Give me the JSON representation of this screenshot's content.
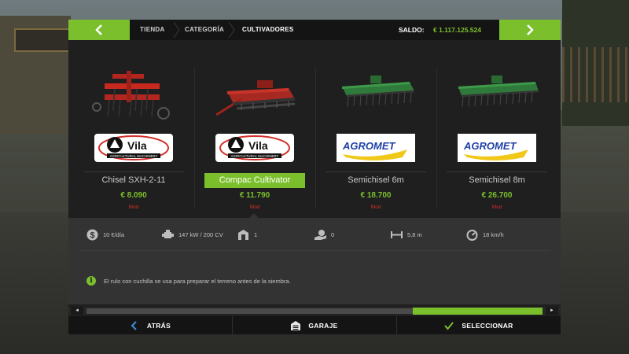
{
  "breadcrumb": [
    "TIENDA",
    "CATEGORÍA",
    "CULTIVADORES"
  ],
  "balance": {
    "label": "SALDO:",
    "value": "€ 1.117.125.524"
  },
  "items": [
    {
      "name": "Chisel SXH-2-11",
      "price": "€ 8.090",
      "tag": "Mod",
      "brand": "Vila",
      "brand_sub": "AGRICULTURAL MACHINERY"
    },
    {
      "name": "Compac Cultivator",
      "price": "€ 11.790",
      "tag": "Mod",
      "brand": "Vila",
      "brand_sub": "AGRICULTURAL MACHINERY"
    },
    {
      "name": "Semichisel 6m",
      "price": "€ 18.700",
      "tag": "Mod",
      "brand": "AGROMET"
    },
    {
      "name": "Semichisel 8m",
      "price": "€ 26.700",
      "tag": "Mod",
      "brand": "AGROMET"
    }
  ],
  "specs": [
    {
      "icon": "dollar-coin-icon",
      "value": "10 €/día"
    },
    {
      "icon": "engine-icon",
      "value": "147 kW / 200 CV"
    },
    {
      "icon": "barn-icon",
      "value": "1"
    },
    {
      "icon": "hand-money-icon",
      "value": "0"
    },
    {
      "icon": "width-icon",
      "value": "5,8 m"
    },
    {
      "icon": "speedometer-icon",
      "value": "18 km/h"
    }
  ],
  "description": "El rulo con cuchilla se usa para preparar el terreno antes de la siembra.",
  "info_icon": "i",
  "buttons": {
    "back": "ATRÁS",
    "garage": "GARAJE",
    "select": "SELECCIONAR"
  },
  "colors": {
    "accent": "#7cbf2d",
    "mod": "#d2302a"
  }
}
